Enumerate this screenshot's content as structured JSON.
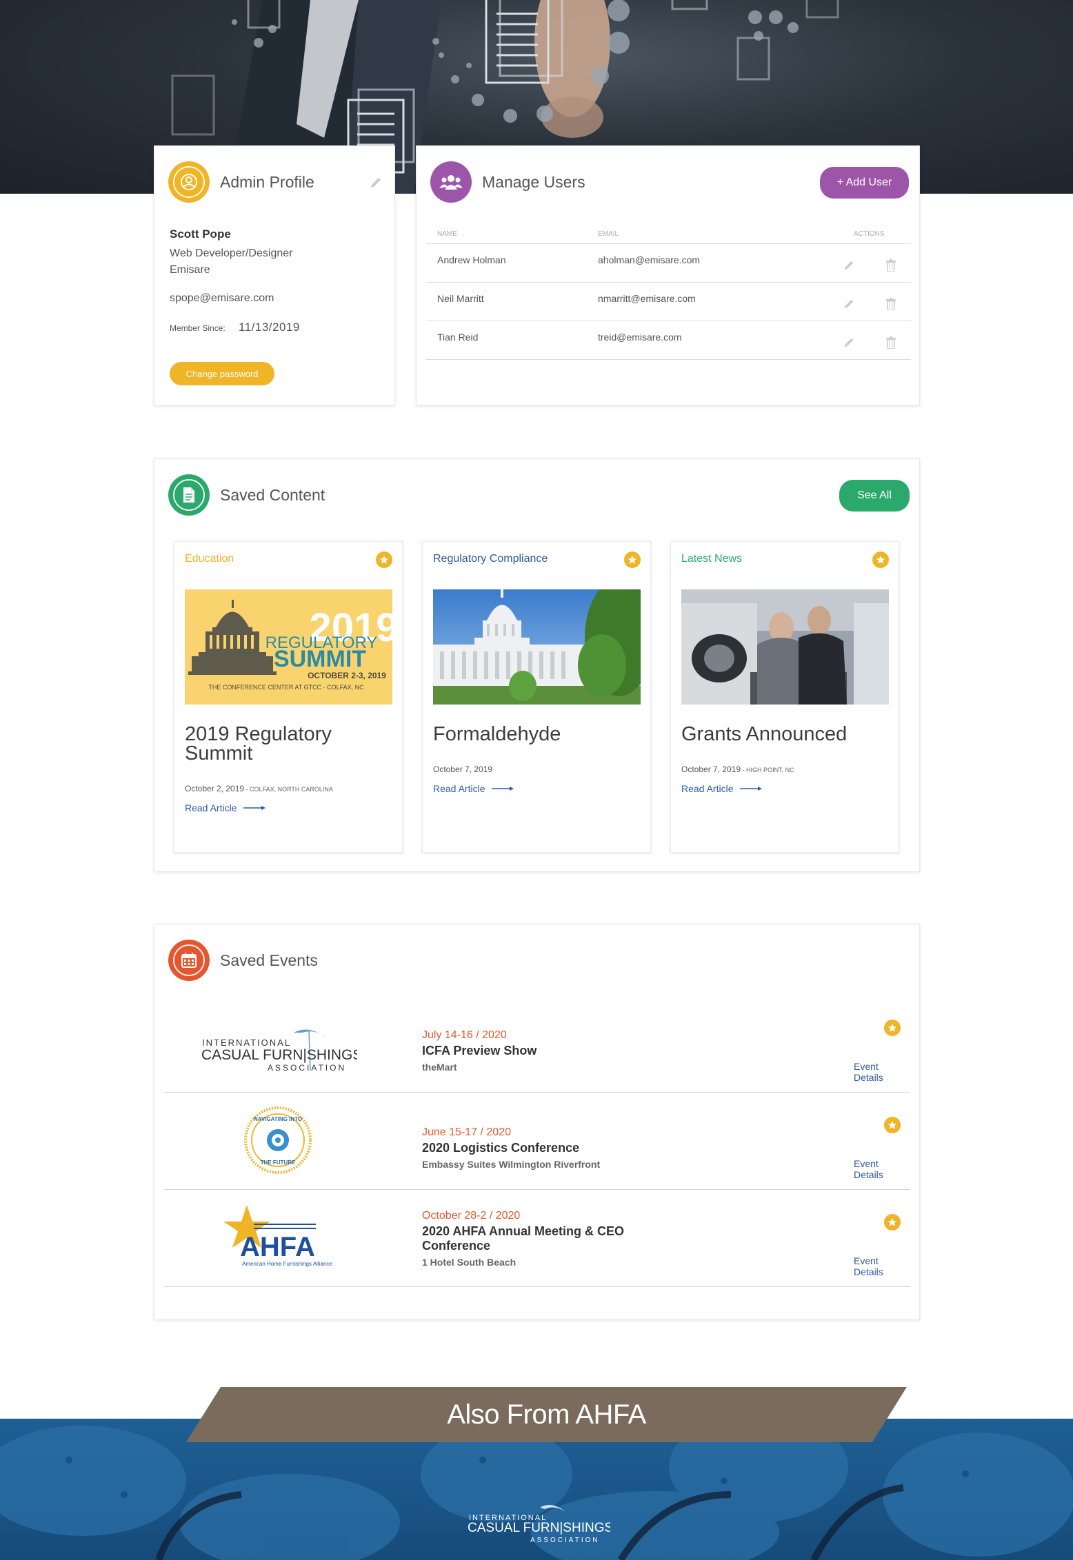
{
  "profile": {
    "title": "Admin Profile",
    "name": "Scott Pope",
    "role": "Web Developer/Designer",
    "company": "Emisare",
    "email": "spope@emisare.com",
    "member_since_label": "Member Since:",
    "member_since": "11/13/2019",
    "change_password": "Change password",
    "accent": "#f0b427"
  },
  "users": {
    "title": "Manage Users",
    "add_label": "+ Add User",
    "columns": [
      "NAME",
      "EMAIL",
      "ACTIONS"
    ],
    "rows": [
      {
        "name": "Andrew Holman",
        "email": "aholman@emisare.com"
      },
      {
        "name": "Neil Marritt",
        "email": "nmarritt@emisare.com"
      },
      {
        "name": "Tian Reid",
        "email": "treid@emisare.com"
      }
    ],
    "accent": "#9c55a8"
  },
  "content": {
    "title": "Saved Content",
    "see_all": "See All",
    "accent": "#2ba86b",
    "articles": [
      {
        "category": "Education",
        "category_color": "#f0b427",
        "title": "2019 Regulatory Summit",
        "date": "October 2, 2019",
        "location": " - COLFAX, NORTH CAROLINA",
        "read": "Read Article",
        "image": {
          "year": "2019",
          "line1": "REGULATORY",
          "line2": "SUMMIT",
          "dates": "OCTOBER 2-3, 2019",
          "venue": "THE CONFERENCE CENTER AT GTCC · COLFAX, NC"
        }
      },
      {
        "category": "Regulatory Compliance",
        "category_color": "#2d5a9e",
        "title": "Formaldehyde",
        "date": "October 7, 2019",
        "location": "",
        "read": "Read Article"
      },
      {
        "category": "Latest News",
        "category_color": "#2ba86b",
        "title": "Grants Announced",
        "date": "October 7, 2019",
        "location": " - HIGH POINT, NC",
        "read": "Read Article"
      }
    ]
  },
  "events": {
    "title": "Saved Events",
    "accent": "#e4572e",
    "items": [
      {
        "date": "July 14-16 / 2020",
        "title": "ICFA Preview Show",
        "venue": "theMart",
        "details": "Event Details",
        "logo": {
          "top": "INTERNATIONAL",
          "mid": "CASUAL FURN|SHINGS",
          "bottom": "ASSOCIATION"
        }
      },
      {
        "date": "June 15-17 / 2020",
        "title": "2020 Logistics Conference",
        "venue": "Embassy Suites Wilmington Riverfront",
        "details": "Event Details",
        "logo": {
          "top": "NAVIGATING INTO",
          "bottom": "THE FUTURE"
        }
      },
      {
        "date": "October 28-2 / 2020",
        "title": "2020 AHFA Annual Meeting & CEO Conference",
        "venue": "1 Hotel South Beach",
        "details": "Event Details",
        "logo": {
          "mid": "AHFA",
          "bottom": "American Home Furnishings Alliance"
        }
      }
    ]
  },
  "footer": {
    "banner": "Also From AHFA",
    "logo": {
      "top": "INTERNATIONAL",
      "mid": "CASUAL FURN|SHINGS",
      "bottom": "ASSOCIATION"
    }
  }
}
